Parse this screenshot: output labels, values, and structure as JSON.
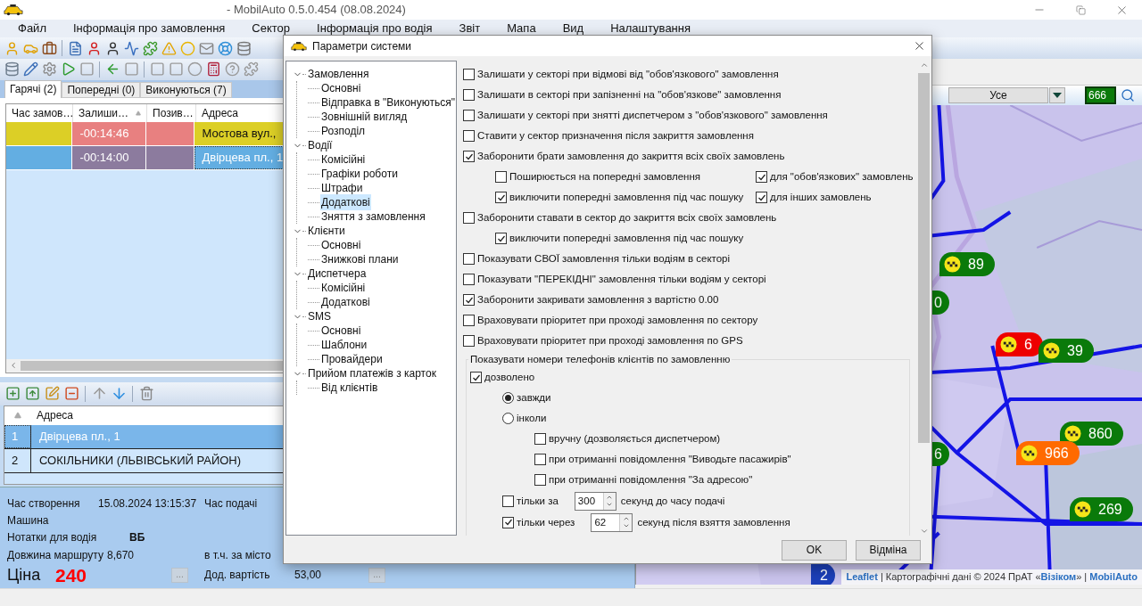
{
  "window": {
    "title": "- MobilAuto 0.5.0.454 (08.08.2024)"
  },
  "menu": [
    "Файл",
    "Інформація про замовлення",
    "Сектор",
    "Інформація про водія",
    "Звіт",
    "Мапа",
    "Вид",
    "Налаштування"
  ],
  "order_tabs": [
    {
      "label": "Гарячі (2)",
      "selected": true
    },
    {
      "label": "Попередні (0)",
      "selected": false
    },
    {
      "label": "Виконуються (7)",
      "selected": false
    }
  ],
  "orders_table": {
    "columns": [
      "Час замов…",
      "Залиши…",
      "Позив…",
      "Адреса"
    ],
    "rows": [
      {
        "selected": false,
        "cells": [
          {
            "color": "#dccf26"
          },
          {
            "text": "-00:14:46",
            "color": "#e88080"
          },
          {
            "color": "#e88080"
          },
          {
            "text": "Мостова вул.,",
            "color": "#dccf26"
          }
        ]
      },
      {
        "selected": true,
        "cells": [
          {
            "color": "#63aee2"
          },
          {
            "text": "-00:14:00",
            "color": "#8c7b9e"
          },
          {
            "color": "#8c7b9e"
          },
          {
            "text": "Двірцева пл., 1",
            "color": "#63aee2"
          }
        ]
      }
    ]
  },
  "route_table": {
    "columns": [
      "Адреса"
    ],
    "rows": [
      {
        "number": "1",
        "address": "Двірцева пл., 1",
        "selected": true
      },
      {
        "number": "2",
        "address": "СОКІЛЬНИКИ (ЛЬВІВСЬКИЙ РАЙОН)",
        "selected": false
      }
    ]
  },
  "order_info": {
    "created_label": "Час створення",
    "created": "15.08.2024 13:15:37",
    "pickup_label": "Час подачі",
    "car_label": "Машина",
    "notes_label": "Нотатки для водія",
    "notes": "ВБ",
    "length_label": "Довжина маршруту",
    "length": "8,670",
    "city_label": "в т.ч. за місто",
    "price_label": "Ціна",
    "price": "240",
    "price_button": "...",
    "extra_label": "Дод. вартість",
    "extra": "53,00",
    "extra_button": "..."
  },
  "map": {
    "filter": "Усе",
    "search": "666",
    "markers": [
      {
        "kind": "taxi",
        "text": "89",
        "color": "#0a7a0a"
      },
      {
        "kind": "cut",
        "text": "0",
        "color": "#0a7a0a"
      },
      {
        "kind": "taxi",
        "text": "6",
        "color": "#ee0000"
      },
      {
        "kind": "taxi",
        "text": "39",
        "color": "#0a7a0a"
      },
      {
        "kind": "taxi",
        "text": "860",
        "color": "#0a7a0a"
      },
      {
        "kind": "taxi",
        "text": "966",
        "color": "#ff6a00"
      },
      {
        "kind": "cut",
        "text": "6",
        "color": "#0a7a0a"
      },
      {
        "kind": "taxi",
        "text": "269",
        "color": "#0a7a0a"
      },
      {
        "kind": "cut",
        "text": "2",
        "color": "#1c3fb8"
      }
    ],
    "attribution": [
      {
        "kind": "link",
        "text": "Leaflet"
      },
      {
        "kind": "text",
        "text": " | Картографічні дані © 2024 ПрАТ «"
      },
      {
        "kind": "link",
        "text": "Візіком"
      },
      {
        "kind": "text",
        "text": "» | "
      },
      {
        "kind": "link",
        "text": "MobilAuto"
      }
    ]
  },
  "dialog": {
    "title": "Параметри системи",
    "tree": [
      {
        "label": "Замовлення",
        "expanded": true,
        "selected": false,
        "children": [
          {
            "label": "Основні",
            "selected": false
          },
          {
            "label": "Відправка в \"Виконуються\"",
            "selected": false
          },
          {
            "label": "Зовнішній вигляд",
            "selected": false
          },
          {
            "label": "Розподіл",
            "selected": false
          }
        ]
      },
      {
        "label": "Водії",
        "expanded": true,
        "selected": false,
        "children": [
          {
            "label": "Комісійні",
            "selected": false
          },
          {
            "label": "Графіки роботи",
            "selected": false
          },
          {
            "label": "Штрафи",
            "selected": false
          },
          {
            "label": "Додаткові",
            "selected": true
          },
          {
            "label": "Зняття з замовлення",
            "selected": false
          }
        ]
      },
      {
        "label": "Клієнти",
        "expanded": true,
        "selected": false,
        "children": [
          {
            "label": "Основні",
            "selected": false
          },
          {
            "label": "Знижкові плани",
            "selected": false
          }
        ]
      },
      {
        "label": "Диспетчера",
        "expanded": true,
        "selected": false,
        "children": [
          {
            "label": "Комісійні",
            "selected": false
          },
          {
            "label": "Додаткові",
            "selected": false
          }
        ]
      },
      {
        "label": "SMS",
        "expanded": true,
        "selected": false,
        "children": [
          {
            "label": "Основні",
            "selected": false
          },
          {
            "label": "Шаблони",
            "selected": false
          },
          {
            "label": "Провайдери",
            "selected": false
          }
        ]
      },
      {
        "label": "Прийом платежів з карток",
        "expanded": true,
        "selected": false,
        "children": [
          {
            "label": "Від клієнтів",
            "selected": false
          }
        ]
      }
    ],
    "options": [
      {
        "kind": "checkbox",
        "label": "Залишати у секторі при відмові від \"обов'язкового\" замовлення",
        "checked": false
      },
      {
        "kind": "checkbox",
        "label": "Залишати в секторі при запізненні на \"обов'язкове\" замовлення",
        "checked": false
      },
      {
        "kind": "checkbox",
        "label": "Залишати у секторі при знятті диспетчером з \"обов'язкового\" замовлення",
        "checked": false
      },
      {
        "kind": "checkbox",
        "label": "Ставити у сектор призначення після закриття замовлення",
        "checked": false
      },
      {
        "kind": "checkbox",
        "label": "Заборонити брати замовлення до закриття всіх своїх замовлень",
        "checked": true,
        "children": [
          {
            "kind": "checkbox",
            "label": "Поширюється на попередні замовлення",
            "checked": false
          },
          {
            "kind": "checkbox",
            "label": "для \"обов'язкових\" замовлень",
            "checked": true
          },
          {
            "kind": "checkbox",
            "label": "виключити попередні замовлення під час пошуку",
            "checked": true
          },
          {
            "kind": "checkbox",
            "label": "для інших замовлень",
            "checked": true
          }
        ]
      },
      {
        "kind": "checkbox",
        "label": "Заборонити ставати в сектор до закриття всіх своїх замовлень",
        "checked": false,
        "children": [
          {
            "kind": "checkbox",
            "label": "виключити попередні замовлення під час пошуку",
            "checked": true
          }
        ]
      },
      {
        "kind": "checkbox",
        "label": "Показувати СВОЇ замовлення тільки водіям в секторі",
        "checked": false
      },
      {
        "kind": "checkbox",
        "label": "Показувати \"ПЕРЕКІДНІ\" замовлення тільки водіям у секторі",
        "checked": false
      },
      {
        "kind": "checkbox",
        "label": "Заборонити закривати замовлення з вартістю 0.00",
        "checked": true
      },
      {
        "kind": "checkbox",
        "label": "Враховувати пріоритет при проході замовлення по сектору",
        "checked": false
      },
      {
        "kind": "checkbox",
        "label": "Враховувати пріоритет при проході замовлення по GPS",
        "checked": false
      },
      {
        "kind": "group",
        "label": "Показувати номери телефонів клієнтів по замовленню",
        "children": [
          {
            "kind": "checkbox",
            "label": "дозволено",
            "checked": true,
            "children": [
              {
                "kind": "radio",
                "label": "завжди",
                "selected": true
              },
              {
                "kind": "radio",
                "label": "інколи",
                "selected": false,
                "children": [
                  {
                    "kind": "checkbox",
                    "label": "вручну (дозволяється диспетчером)",
                    "checked": false
                  },
                  {
                    "kind": "checkbox",
                    "label": "при отриманні повідомлення \"Виводьте пасажирів\"",
                    "checked": false
                  },
                  {
                    "kind": "checkbox",
                    "label": "при отриманні повідомлення \"За адресою\"",
                    "checked": false
                  }
                ]
              },
              {
                "kind": "spin",
                "label": "тільки за",
                "checked": false,
                "value": "300",
                "suffix": "секунд до часу подачі"
              },
              {
                "kind": "spin",
                "label": "тільки через",
                "checked": true,
                "value": "62",
                "suffix": "секунд після взяття замовлення"
              }
            ]
          }
        ]
      }
    ],
    "buttons": [
      "OK",
      "Відміна"
    ]
  }
}
